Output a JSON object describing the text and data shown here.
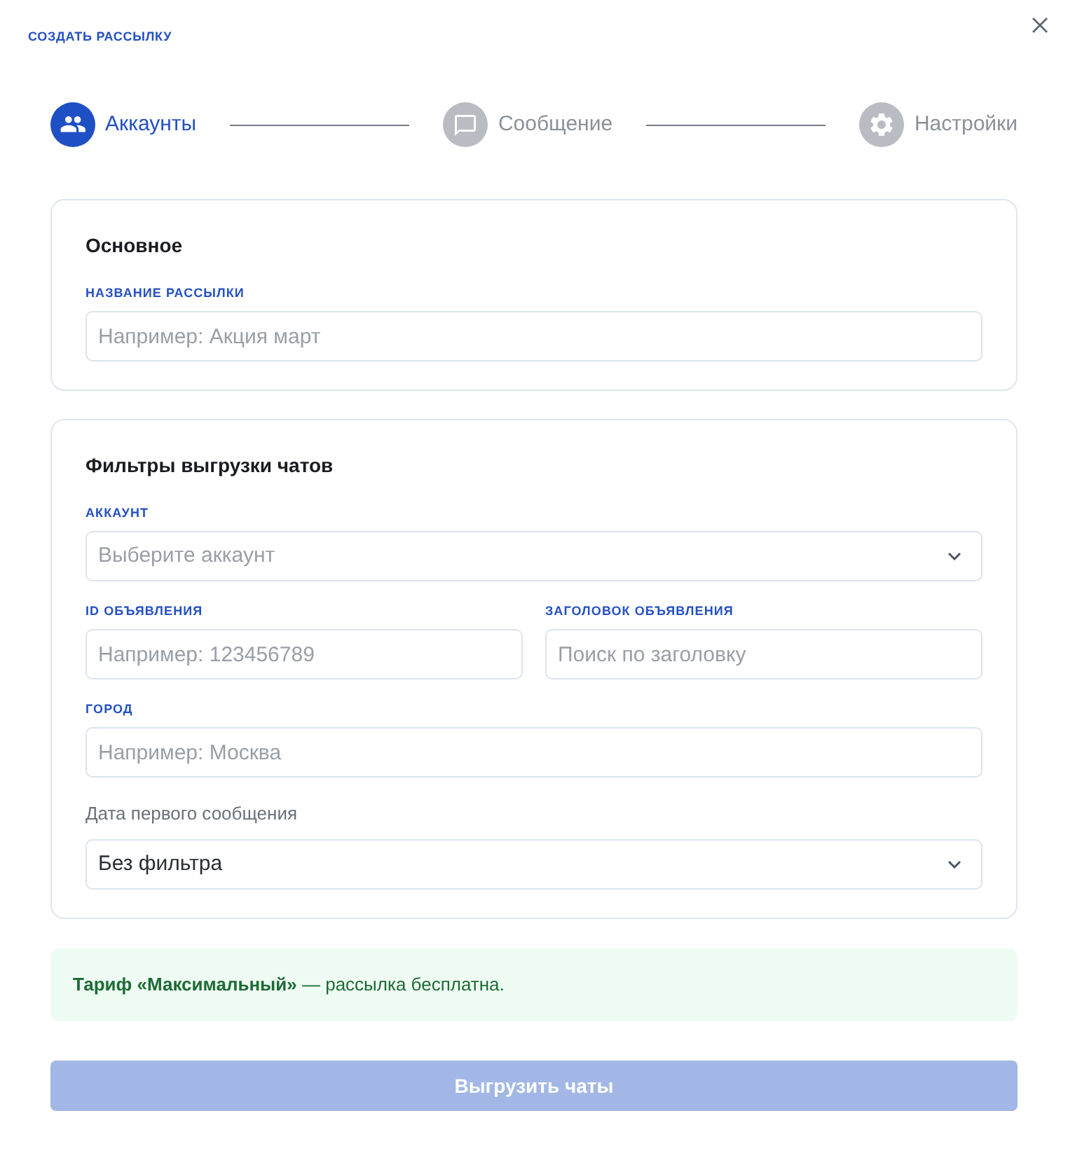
{
  "dialog": {
    "title": "СОЗДАТЬ РАССЫЛКУ"
  },
  "steps": [
    {
      "label": "Аккаунты",
      "selected": true
    },
    {
      "label": "Сообщение",
      "selected": false
    },
    {
      "label": "Настройки",
      "selected": false
    }
  ],
  "sections": [
    {
      "title": "Основное",
      "rows": [
        [
          {
            "kind": "input",
            "label": {
              "kind": "caption",
              "text": "НАЗВАНИЕ РАССЫЛКИ"
            },
            "placeholder": "Например: Акция март"
          }
        ]
      ]
    },
    {
      "title": "Фильтры выгрузки чатов",
      "rows": [
        [
          {
            "kind": "select",
            "label": {
              "kind": "caption",
              "text": "АККАУНТ"
            },
            "placeholder": "Выберите аккаунт"
          }
        ],
        [
          {
            "kind": "input",
            "label": {
              "kind": "caption",
              "text": "ID ОБЪЯВЛЕНИЯ"
            },
            "placeholder": "Например: 123456789"
          },
          {
            "kind": "input",
            "label": {
              "kind": "caption",
              "text": "ЗАГОЛОВОК ОБЪЯВЛЕНИЯ"
            },
            "placeholder": "Поиск по заголовку"
          }
        ],
        [
          {
            "kind": "input",
            "label": {
              "kind": "caption",
              "text": "ГОРОД"
            },
            "placeholder": "Например: Москва"
          }
        ],
        [
          {
            "kind": "select",
            "label": {
              "kind": "plain",
              "text": "Дата первого сообщения"
            },
            "value": "Без фильтра"
          }
        ]
      ]
    }
  ],
  "notice": {
    "text": "**Тариф «Максимальный»** — рассылка бесплатна."
  },
  "submit_button": {
    "label": "Выгрузить чаты",
    "disabled": true
  }
}
